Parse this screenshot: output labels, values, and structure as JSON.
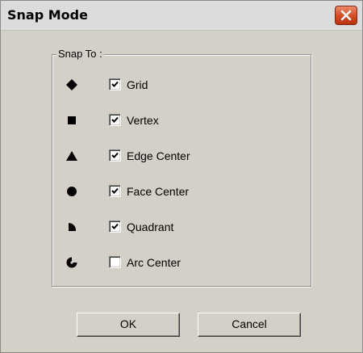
{
  "window": {
    "title": "Snap Mode",
    "close_icon": "close-x-icon"
  },
  "group": {
    "label": "Snap To :"
  },
  "options": [
    {
      "label": "Grid",
      "checked": true,
      "icon": "diamond-icon"
    },
    {
      "label": "Vertex",
      "checked": true,
      "icon": "square-icon"
    },
    {
      "label": "Edge Center",
      "checked": true,
      "icon": "triangle-icon"
    },
    {
      "label": "Face Center",
      "checked": true,
      "icon": "circle-icon"
    },
    {
      "label": "Quadrant",
      "checked": true,
      "icon": "quadrant-icon"
    },
    {
      "label": "Arc Center",
      "checked": false,
      "icon": "arc-center-icon"
    }
  ],
  "buttons": {
    "ok": "OK",
    "cancel": "Cancel"
  },
  "colors": {
    "dialog_bg": "#d4d0c8",
    "close_button": "#d04a22"
  }
}
